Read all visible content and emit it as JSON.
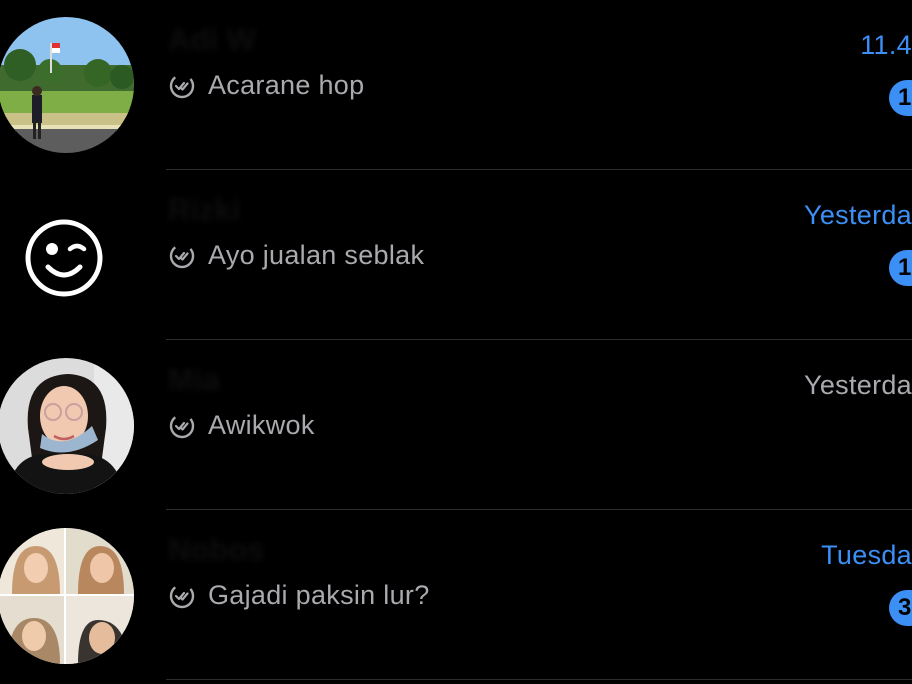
{
  "colors": {
    "background": "#000000",
    "accent": "#3b8ff5",
    "message_text": "#a9a9ae",
    "time_read": "#a9a9ae",
    "divider": "#2c2c2e"
  },
  "chats": [
    {
      "name": "Adi W",
      "message": "Acarane hop",
      "time": "11.4",
      "time_unread": true,
      "unread_count": "1",
      "status_icon": "double-check-icon",
      "avatar": "outdoor-photo"
    },
    {
      "name": "Rizki",
      "message": "Ayo jualan seblak",
      "time": "Yesterda",
      "time_unread": true,
      "unread_count": "1",
      "status_icon": "double-check-icon",
      "avatar": "winking-face"
    },
    {
      "name": "Mia",
      "message": "Awikwok",
      "time": "Yesterda",
      "time_unread": false,
      "unread_count": "",
      "status_icon": "double-check-icon",
      "avatar": "selfie-photo"
    },
    {
      "name": "Nobos",
      "message": "Gajadi paksin lur?",
      "time": "Tuesda",
      "time_unread": true,
      "unread_count": "3",
      "status_icon": "double-check-icon",
      "avatar": "collage-photo"
    }
  ]
}
